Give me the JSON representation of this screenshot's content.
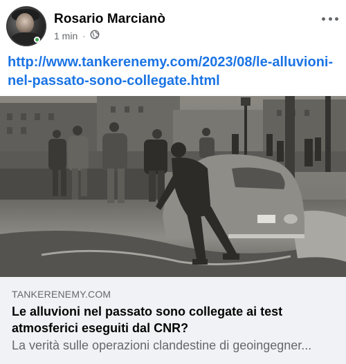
{
  "post": {
    "author": "Rosario Marcianò",
    "time": "1 min",
    "separator": "·",
    "privacy_icon": "globe-icon",
    "more_icon": "more-options-icon",
    "link_text": "http://www.tankerenemy.com/2023/08/le-alluvioni-nel-passato-sono-collegate.html"
  },
  "link_card": {
    "domain": "TANKERENEMY.COM",
    "title": "Le alluvioni nel passato sono collegate ai test atmosferici eseguiti dal CNR?",
    "description": "La verità sulle operazioni clandestine di geoingegner..."
  },
  "colors": {
    "link": "#1b74e4",
    "secondary_text": "#65676b",
    "card_background": "#f0f2f5",
    "online_dot": "#31a24c"
  }
}
